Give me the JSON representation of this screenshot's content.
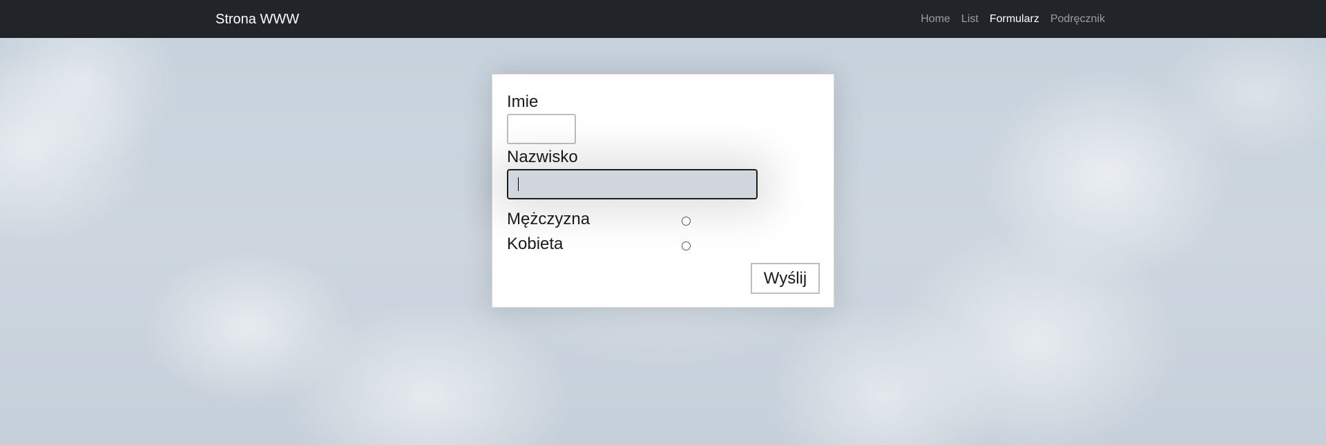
{
  "navbar": {
    "brand": "Strona WWW",
    "links": [
      {
        "label": "Home",
        "active": false
      },
      {
        "label": "List",
        "active": false
      },
      {
        "label": "Formularz",
        "active": true
      },
      {
        "label": "Podręcznik",
        "active": false
      }
    ],
    "background_color": "#212529"
  },
  "form": {
    "first_name": {
      "label": "Imie",
      "value": ""
    },
    "last_name": {
      "label": "Nazwisko",
      "value": "",
      "focused": true
    },
    "gender": {
      "options": [
        {
          "label": "Mężczyzna",
          "checked": false
        },
        {
          "label": "Kobieta",
          "checked": false
        }
      ]
    },
    "submit_label": "Wyślij"
  },
  "colors": {
    "sky": "#c9d3dd",
    "card": "#ffffff",
    "focused_input_bg": "#d2d7df"
  }
}
